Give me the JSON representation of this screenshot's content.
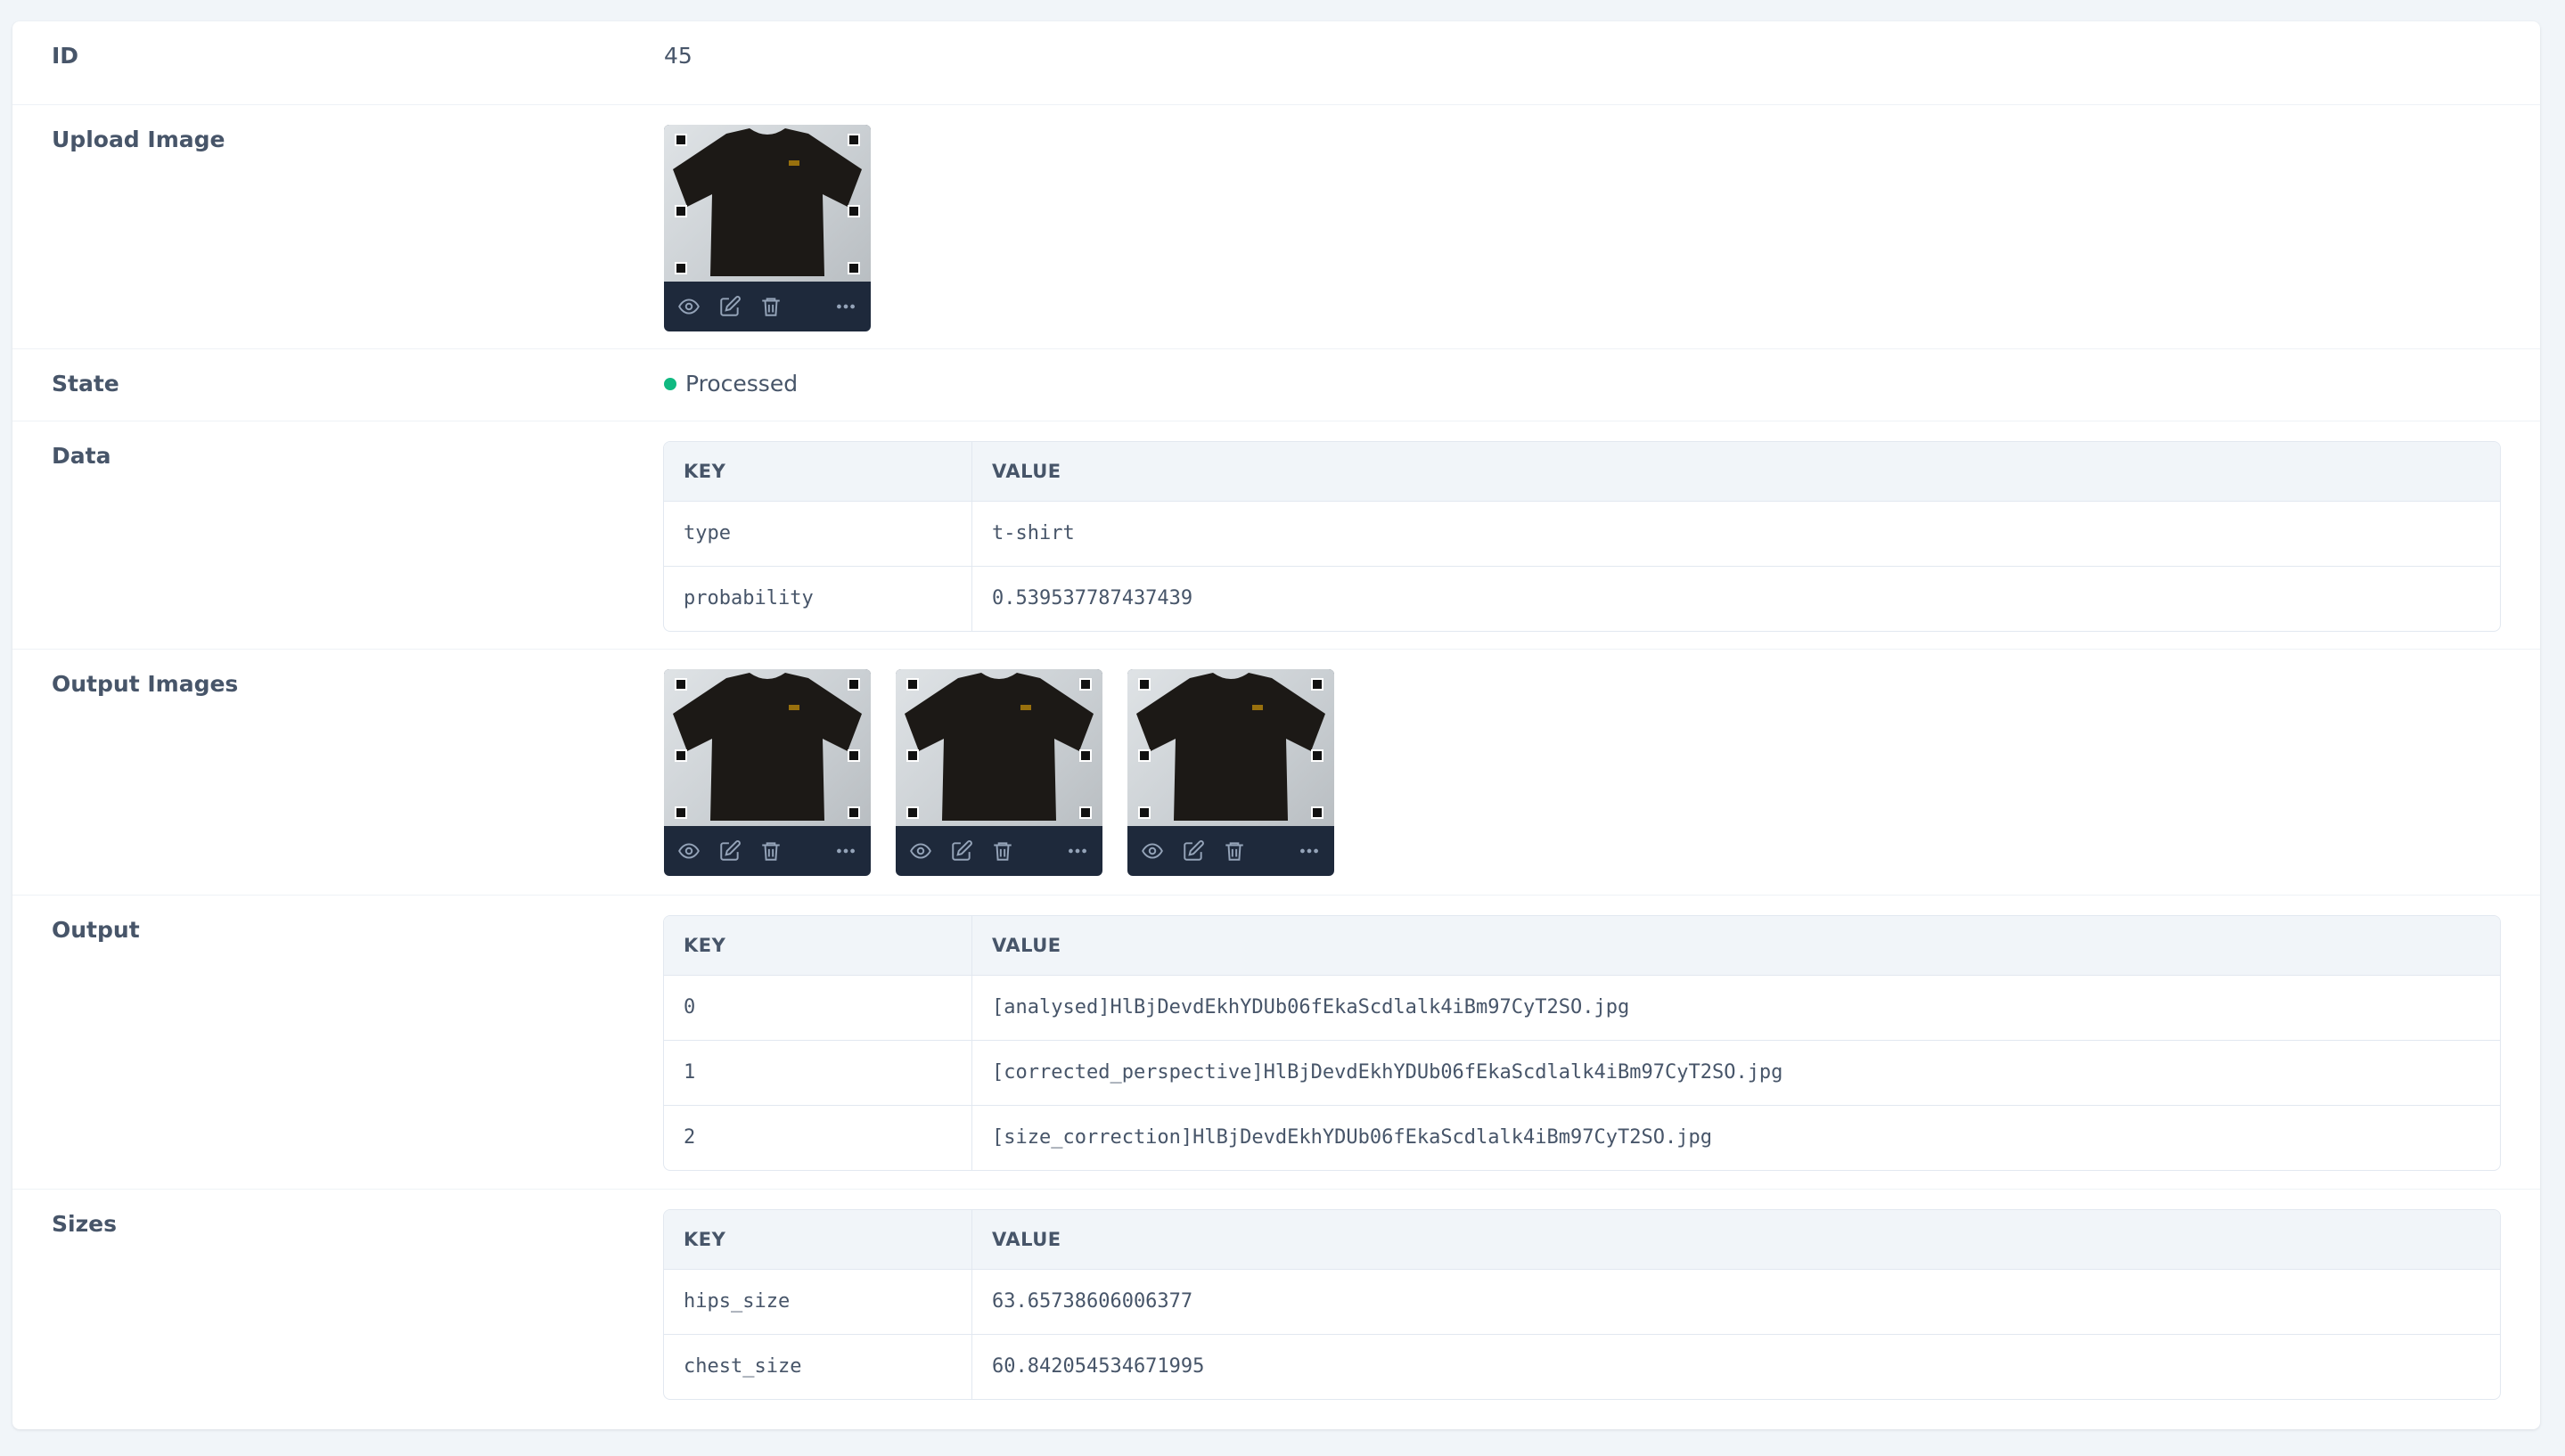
{
  "colors": {
    "state_dot": "#10b981",
    "tile_bar": "#1e293b",
    "page_bg": "#f1f5f9"
  },
  "fields": {
    "id": {
      "label": "ID",
      "value": "45"
    },
    "upload_image": {
      "label": "Upload Image",
      "tiles": 1
    },
    "state": {
      "label": "State",
      "value": "Processed"
    },
    "data": {
      "label": "Data",
      "key_header": "KEY",
      "value_header": "VALUE",
      "rows": [
        {
          "key": "type",
          "value": "t-shirt"
        },
        {
          "key": "probability",
          "value": "0.539537787437439"
        }
      ]
    },
    "output_images": {
      "label": "Output Images",
      "tiles": 3
    },
    "output": {
      "label": "Output",
      "key_header": "KEY",
      "value_header": "VALUE",
      "rows": [
        {
          "key": "0",
          "value": "[analysed]HlBjDevdEkhYDUb06fEkaScdlalk4iBm97CyT2SO.jpg"
        },
        {
          "key": "1",
          "value": "[corrected_perspective]HlBjDevdEkhYDUb06fEkaScdlalk4iBm97CyT2SO.jpg"
        },
        {
          "key": "2",
          "value": "[size_correction]HlBjDevdEkhYDUb06fEkaScdlalk4iBm97CyT2SO.jpg"
        }
      ]
    },
    "sizes": {
      "label": "Sizes",
      "key_header": "KEY",
      "value_header": "VALUE",
      "rows": [
        {
          "key": "hips_size",
          "value": "63.65738606006377"
        },
        {
          "key": "chest_size",
          "value": "60.842054534671995"
        }
      ]
    }
  },
  "tile_icons": [
    "eye-icon",
    "edit-icon",
    "trash-icon",
    "more-icon"
  ]
}
